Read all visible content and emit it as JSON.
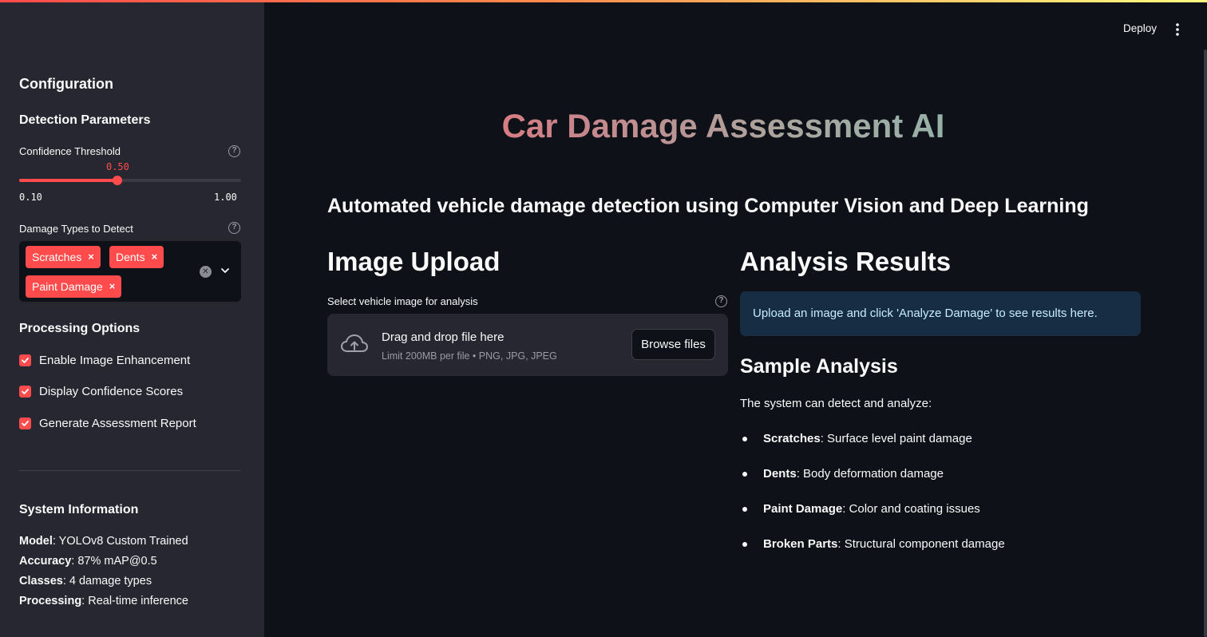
{
  "header": {
    "deploy_label": "Deploy",
    "menu_icon": "kebab-menu-icon"
  },
  "sidebar": {
    "title": "Configuration",
    "detection": {
      "heading": "Detection Parameters",
      "confidence": {
        "label": "Confidence Threshold",
        "value": "0.50",
        "value_fraction": 0.444,
        "min": "0.10",
        "max": "1.00"
      },
      "damage_types": {
        "label": "Damage Types to Detect",
        "selected": [
          "Scratches",
          "Dents",
          "Paint Damage"
        ],
        "remove_glyph": "×"
      }
    },
    "processing": {
      "heading": "Processing Options",
      "options": [
        {
          "label": "Enable Image Enhancement",
          "checked": true
        },
        {
          "label": "Display Confidence Scores",
          "checked": true
        },
        {
          "label": "Generate Assessment Report",
          "checked": true
        }
      ]
    },
    "system_info": {
      "heading": "System Information",
      "items": [
        {
          "key": "Model",
          "value": ": YOLOv8 Custom Trained"
        },
        {
          "key": "Accuracy",
          "value": ": 87% mAP@0.5"
        },
        {
          "key": "Classes",
          "value": ": 4 damage types"
        },
        {
          "key": "Processing",
          "value": ": Real-time inference"
        }
      ]
    }
  },
  "main": {
    "title": "Car Damage Assessment AI",
    "subtitle": "Automated vehicle damage detection using Computer Vision and Deep Learning",
    "upload": {
      "heading": "Image Upload",
      "label": "Select vehicle image for analysis",
      "drop_title": "Drag and drop file here",
      "drop_sub": "Limit 200MB per file • PNG, JPG, JPEG",
      "browse_label": "Browse files"
    },
    "results": {
      "heading": "Analysis Results",
      "info": "Upload an image and click 'Analyze Damage' to see results here.",
      "sample_heading": "Sample Analysis",
      "sample_intro": "The system can detect and analyze:",
      "items": [
        {
          "term": "Scratches",
          "desc": ": Surface level paint damage"
        },
        {
          "term": "Dents",
          "desc": ": Body deformation damage"
        },
        {
          "term": "Paint Damage",
          "desc": ": Color and coating issues"
        },
        {
          "term": "Broken Parts",
          "desc": ": Structural component damage"
        }
      ]
    }
  },
  "colors": {
    "accent": "#ff4b4b",
    "background": "#0e1117",
    "sidebar": "#262730",
    "info_bg": "#172d43"
  }
}
